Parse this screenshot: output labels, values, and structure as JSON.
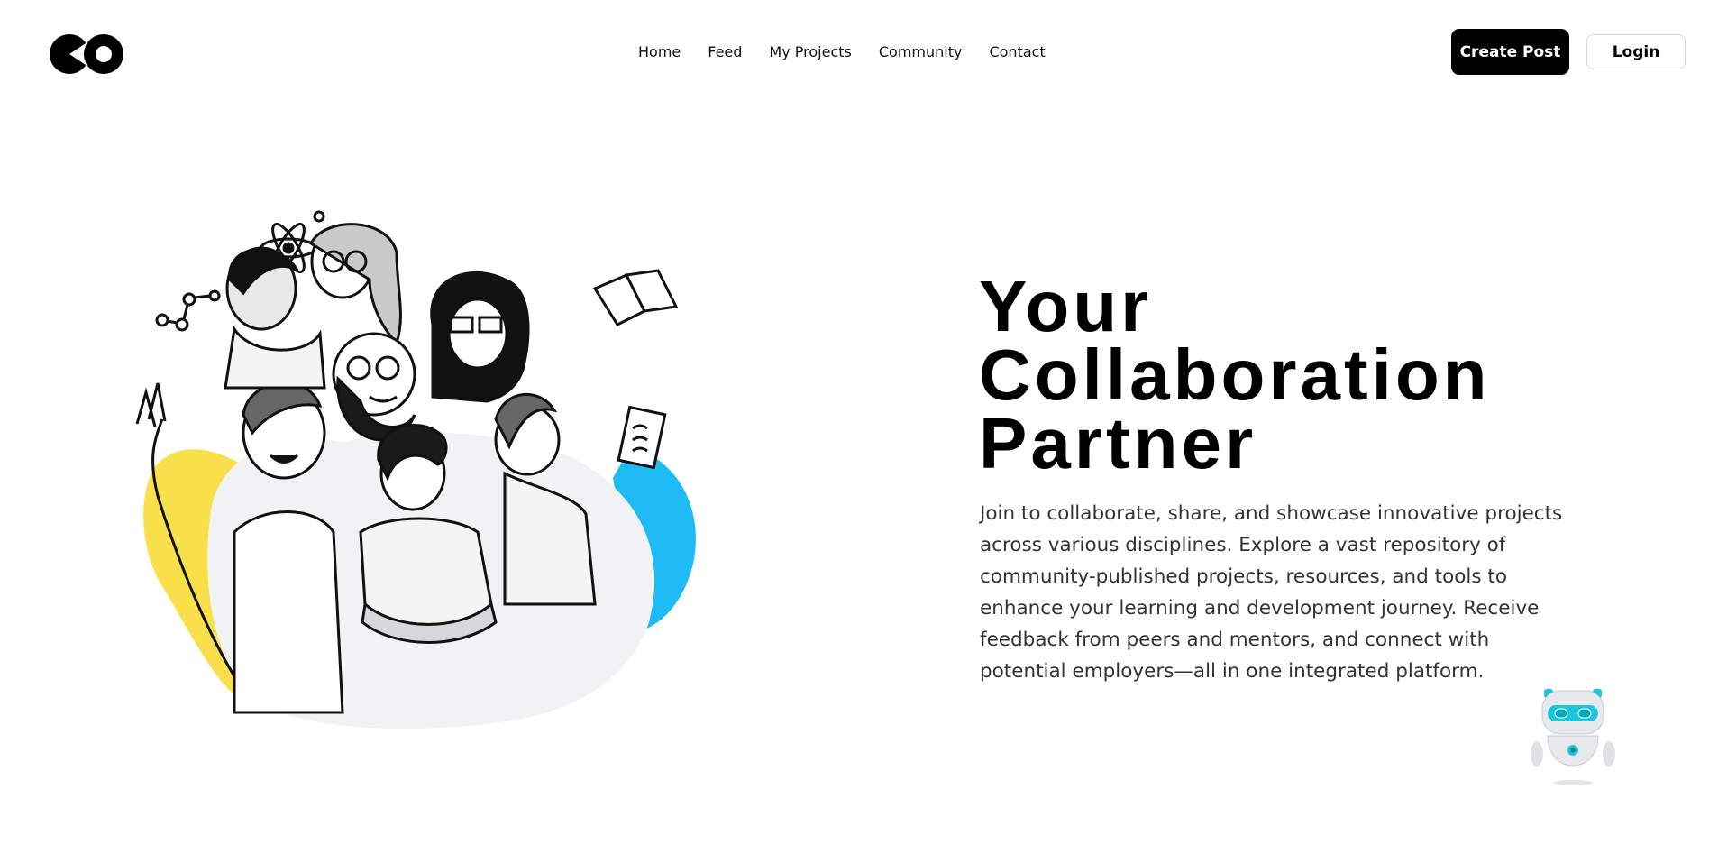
{
  "header": {
    "logo_alt": "CO",
    "nav": [
      {
        "label": "Home"
      },
      {
        "label": "Feed"
      },
      {
        "label": "My Projects"
      },
      {
        "label": "Community"
      },
      {
        "label": "Contact"
      }
    ],
    "create_post_label": "Create Post",
    "login_label": "Login"
  },
  "hero": {
    "title_lines": [
      "Your",
      "Collaboration",
      "Partner"
    ],
    "description": "Join to collaborate, share, and showcase innovative projects across various disciplines. Explore a vast repository of community-published projects, resources, and tools to enhance your learning and development journey. Receive feedback from peers and mentors, and connect with potential employers—all in one integrated platform."
  },
  "colors": {
    "primary_button": "#000000",
    "accent_yellow": "#F9DF4A",
    "accent_blue": "#1EBBF5",
    "robot_accent": "#1BC6DB"
  },
  "icons": [
    "logo-icon",
    "atom-icon",
    "molecule-icon",
    "book-icon",
    "document-icon",
    "robot-assistant-icon"
  ]
}
